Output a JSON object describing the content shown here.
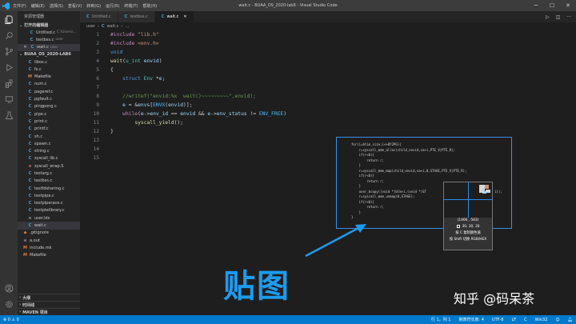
{
  "window": {
    "title": "wait.c - BUAA_OS_2020-lab6 - Visual Studio Code",
    "menu": [
      "文件(F)",
      "编辑(E)",
      "选择(S)",
      "查看(V)",
      "转到(G)",
      "运行(R)",
      "终端(T)",
      "帮助(H)"
    ]
  },
  "sidebar": {
    "header": "资源管理器",
    "open_editors": {
      "title": "打开的编辑器",
      "items": [
        {
          "name": "Untitled.c",
          "path": "C:\\Users\\..."
        },
        {
          "name": "testbss.c",
          "path": "user"
        },
        {
          "name": "wait.c",
          "path": "user"
        }
      ]
    },
    "project": {
      "title": "BUAA_OS_2020-LAB6",
      "files": [
        {
          "name": "libos.c",
          "type": "c"
        },
        {
          "name": "fs.c",
          "type": "c"
        },
        {
          "name": "Makefile",
          "type": "m"
        },
        {
          "name": "num.c",
          "type": "c"
        },
        {
          "name": "pageref.c",
          "type": "c"
        },
        {
          "name": "pgfault.c",
          "type": "c"
        },
        {
          "name": "pingpong.c",
          "type": "c"
        },
        {
          "name": "pipe.c",
          "type": "c"
        },
        {
          "name": "print.c",
          "type": "c"
        },
        {
          "name": "printf.c",
          "type": "c"
        },
        {
          "name": "sh.c",
          "type": "c"
        },
        {
          "name": "spawn.c",
          "type": "c"
        },
        {
          "name": "string.c",
          "type": "c"
        },
        {
          "name": "syscall_lib.c",
          "type": "c"
        },
        {
          "name": "syscall_wrap.S",
          "type": "s"
        },
        {
          "name": "testarg.c",
          "type": "c"
        },
        {
          "name": "testbss.c",
          "type": "c"
        },
        {
          "name": "testfdsharing.c",
          "type": "c"
        },
        {
          "name": "testpipe.c",
          "type": "c"
        },
        {
          "name": "testpiperace.c",
          "type": "c"
        },
        {
          "name": "testptelibrary.c",
          "type": "c"
        },
        {
          "name": "user.lds",
          "type": "l"
        },
        {
          "name": "wait.c",
          "type": "c"
        },
        {
          "name": ".gitignore",
          "type": "g"
        },
        {
          "name": "a.out",
          "type": "l"
        },
        {
          "name": "include.mk",
          "type": "m"
        },
        {
          "name": "Makefile",
          "type": "m"
        }
      ]
    },
    "bottom_sections": [
      "大纲",
      "时间线",
      "MAVEN 项目"
    ]
  },
  "tabs": [
    {
      "label": "Untitled.c",
      "active": false
    },
    {
      "label": "testbss.c",
      "active": false
    },
    {
      "label": "wait.c",
      "active": true
    }
  ],
  "breadcrumb": [
    "user",
    "wait.c",
    "..."
  ],
  "code": [
    [
      {
        "t": "#include ",
        "c": "pp"
      },
      {
        "t": "\"lib.h\"",
        "c": "str"
      }
    ],
    [
      {
        "t": "#include ",
        "c": "pp"
      },
      {
        "t": "<env.h>",
        "c": "str"
      }
    ],
    [
      {
        "t": "void",
        "c": "kw"
      }
    ],
    [
      {
        "t": "wait",
        "c": "fn"
      },
      {
        "t": "(",
        "c": "plain"
      },
      {
        "t": "u_int",
        "c": "ty"
      },
      {
        "t": " envid",
        "c": "var"
      },
      {
        "t": ")",
        "c": "plain"
      }
    ],
    [
      {
        "t": "{",
        "c": "plain"
      }
    ],
    [
      {
        "t": "    struct ",
        "c": "kw"
      },
      {
        "t": "Env",
        "c": "ty"
      },
      {
        "t": " *",
        "c": "plain"
      },
      {
        "t": "e",
        "c": "var"
      },
      {
        "t": ";",
        "c": "plain"
      }
    ],
    [],
    [
      {
        "t": "    //writef(\"envid:%x  wait()~~~~~~~~~\",envid);",
        "c": "cm"
      }
    ],
    [
      {
        "t": "    e",
        "c": "var"
      },
      {
        "t": " = &",
        "c": "plain"
      },
      {
        "t": "envs",
        "c": "var"
      },
      {
        "t": "[",
        "c": "plain"
      },
      {
        "t": "ENVX",
        "c": "mac"
      },
      {
        "t": "(",
        "c": "plain"
      },
      {
        "t": "envid",
        "c": "var"
      },
      {
        "t": ")];",
        "c": "plain"
      }
    ],
    [
      {
        "t": "    while",
        "c": "pp"
      },
      {
        "t": "(",
        "c": "plain"
      },
      {
        "t": "e",
        "c": "var"
      },
      {
        "t": "->",
        "c": "plain"
      },
      {
        "t": "env_id",
        "c": "var"
      },
      {
        "t": " == ",
        "c": "plain"
      },
      {
        "t": "envid",
        "c": "var"
      },
      {
        "t": " && ",
        "c": "plain"
      },
      {
        "t": "e",
        "c": "var"
      },
      {
        "t": "->",
        "c": "plain"
      },
      {
        "t": "env_status",
        "c": "var"
      },
      {
        "t": " != ",
        "c": "plain"
      },
      {
        "t": "ENV_FREE",
        "c": "mac"
      },
      {
        "t": ")",
        "c": "plain"
      }
    ],
    [
      {
        "t": "        syscall_yield",
        "c": "fn"
      },
      {
        "t": "();",
        "c": "plain"
      }
    ],
    [
      {
        "t": "}",
        "c": "plain"
      }
    ],
    [],
    [],
    []
  ],
  "screenshot_code": [
    "for(i=btim_size;i<+BY2PG){",
    "    r=syscall_mem_alloc(child_envid,va+i,PTE_V|PTE_R);",
    "    if(r<0){",
    "        return r;",
    "    }",
    "    r=syscall_mem_map(child_envid,va+i,0,STAGE,PTE_V|PTE_R);",
    "    if(r<0){",
    "        return r;",
    "    }",
    "    user_bcopy((void *)blk+i,(void *)ST",
    "    r=syscall_mem_unmap(0,STAGE);",
    "    if(r<0){",
    "        return r;",
    "    }",
    "}"
  ],
  "screenshot_code_tail": "i));",
  "magnifier": {
    "coords": "(1466 , 583)",
    "rgb": "30,  30,  30",
    "hint1": "按 C 复制颜色值",
    "hint2": "按 Shift 切换 RGB/HEX"
  },
  "annotation": "贴图",
  "watermark": "知乎 @码呆茶",
  "status": {
    "left": "⊗ 0  ⚠ 0",
    "position": "行 1，列 1",
    "indent": "制表符长度: 4",
    "encoding": "UTF-8",
    "eol": "LF",
    "language": "C",
    "platform": "Win32"
  },
  "colors": {
    "accent": "#007acc",
    "annotation": "#1b9cf0",
    "selection_border": "#3a8ee6"
  }
}
